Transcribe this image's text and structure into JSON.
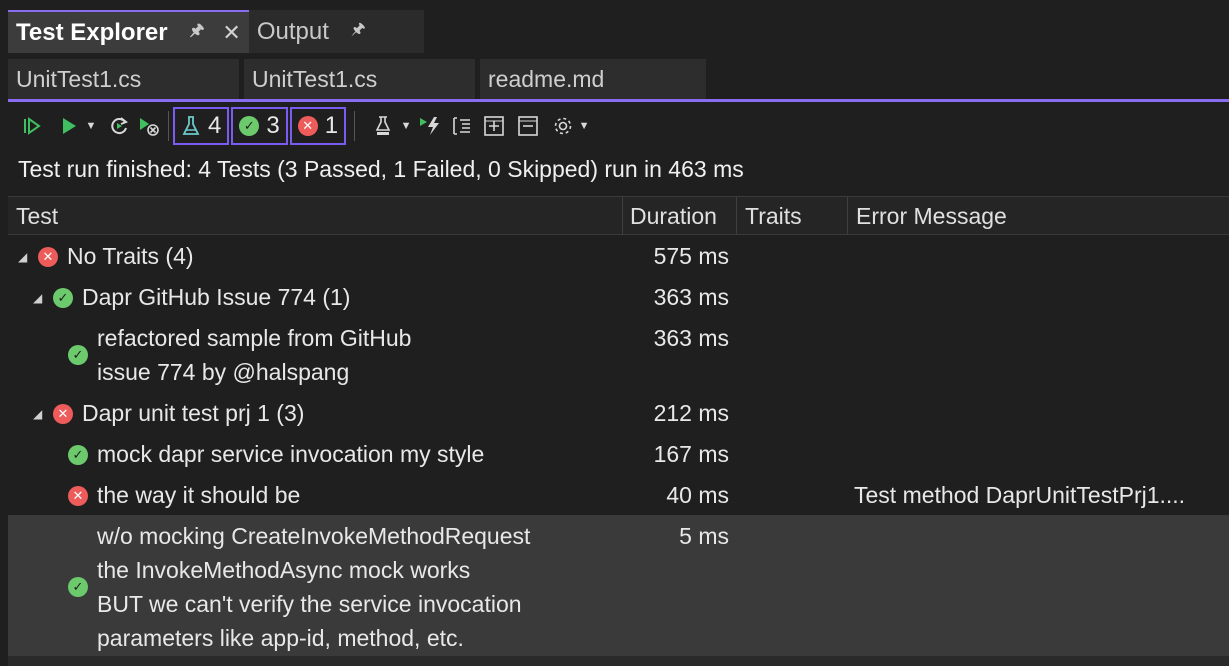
{
  "tool_tabs": {
    "test_explorer": "Test Explorer",
    "output": "Output",
    "pin_glyph": "🖈",
    "close_glyph": "✕"
  },
  "doc_tabs": [
    "UnitTest1.cs",
    "UnitTest1.cs",
    "readme.md"
  ],
  "toolbar": {
    "total_count": "4",
    "passed_count": "3",
    "failed_count": "1"
  },
  "status": "Test run finished: 4 Tests (3 Passed, 1 Failed, 0 Skipped) run in 463 ms",
  "columns": {
    "test": "Test",
    "duration": "Duration",
    "traits": "Traits",
    "error": "Error Message"
  },
  "rows": [
    {
      "level": 0,
      "expander": true,
      "state": "fail",
      "lines": [
        "No Traits (4)"
      ],
      "duration": "575 ms",
      "error": ""
    },
    {
      "level": 1,
      "expander": true,
      "state": "pass",
      "lines": [
        "Dapr GitHub Issue 774 (1)"
      ],
      "duration": "363 ms",
      "error": ""
    },
    {
      "level": 2,
      "expander": false,
      "state": "pass",
      "lines": [
        "refactored sample from GitHub",
        "issue 774 by @halspang"
      ],
      "duration": "363 ms",
      "error": ""
    },
    {
      "level": 1,
      "expander": true,
      "state": "fail",
      "lines": [
        "Dapr unit test prj 1 (3)"
      ],
      "duration": "212 ms",
      "error": ""
    },
    {
      "level": 2,
      "expander": false,
      "state": "pass",
      "lines": [
        "mock dapr service invocation my style"
      ],
      "duration": "167 ms",
      "error": ""
    },
    {
      "level": 2,
      "expander": false,
      "state": "fail",
      "lines": [
        "the way it should be"
      ],
      "duration": "40 ms",
      "error": "Test method DaprUnitTestPrj1...."
    },
    {
      "level": 2,
      "expander": false,
      "state": "pass",
      "selected": true,
      "lines": [
        "w/o mocking CreateInvokeMethodRequest",
        "the InvokeMethodAsync mock works",
        "BUT we can't verify the service invocation",
        "parameters like app-id, method, etc."
      ],
      "duration": "5 ms",
      "error": ""
    }
  ],
  "colors": {
    "accent": "#8a6cf0",
    "pass": "#6cc96c",
    "fail": "#ee5b5b",
    "background": "#1f1f1f"
  }
}
